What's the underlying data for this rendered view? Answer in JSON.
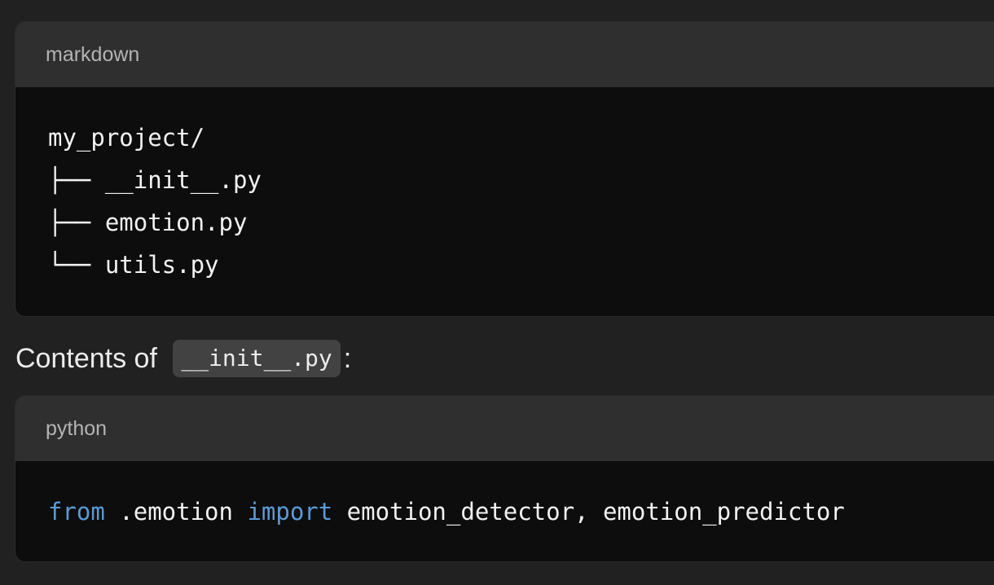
{
  "code_blocks": {
    "tree": {
      "language": "markdown",
      "lines": [
        "my_project/",
        "├── __init__.py",
        "├── emotion.py",
        "└── utils.py"
      ]
    },
    "init_file": {
      "language": "python",
      "tokens": {
        "kw_from": "from",
        "module": " .emotion ",
        "kw_import": "import",
        "names": " emotion_detector, emotion_predictor"
      }
    }
  },
  "paragraph": {
    "prefix": "Contents of ",
    "inline_code": "__init__.py",
    "suffix": ":"
  },
  "colors": {
    "page_background": "#212121",
    "code_header_background": "#2f2f2f",
    "code_body_background": "#0d0d0d",
    "keyword": "#5b9ad6",
    "inline_code_background": "#424242"
  }
}
